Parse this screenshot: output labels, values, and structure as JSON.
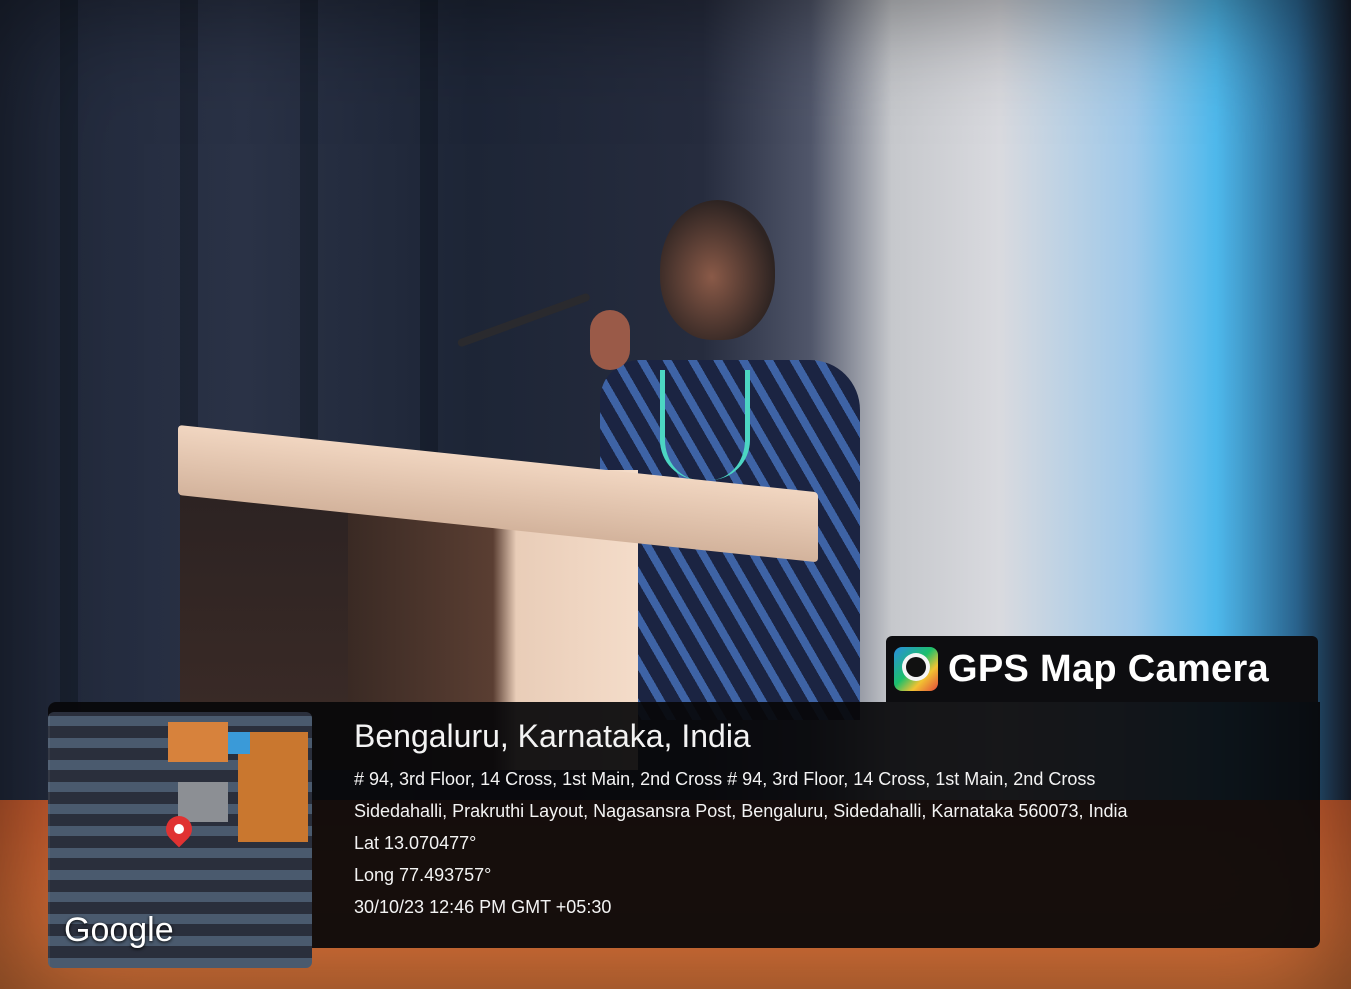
{
  "overlay": {
    "brand": "GPS Map Camera",
    "brand_icon": "gps-map-camera-logo-icon",
    "map_attribution": "Google",
    "location_title": "Bengaluru, Karnataka, India",
    "address_line_1": "# 94, 3rd Floor, 14 Cross, 1st Main, 2nd Cross # 94, 3rd Floor, 14 Cross, 1st Main, 2nd Cross",
    "address_line_2": "Sidedahalli, Prakruthi Layout, Nagasansra Post, Bengaluru, Sidedahalli, Karnataka 560073, India",
    "latitude": "Lat 13.070477°",
    "longitude": "Long 77.493757°",
    "timestamp": "30/10/23 12:46 PM GMT +05:30"
  },
  "colors": {
    "panel_bg": "#0d0d10",
    "pin": "#e03232",
    "text": "#f3f3f3"
  }
}
